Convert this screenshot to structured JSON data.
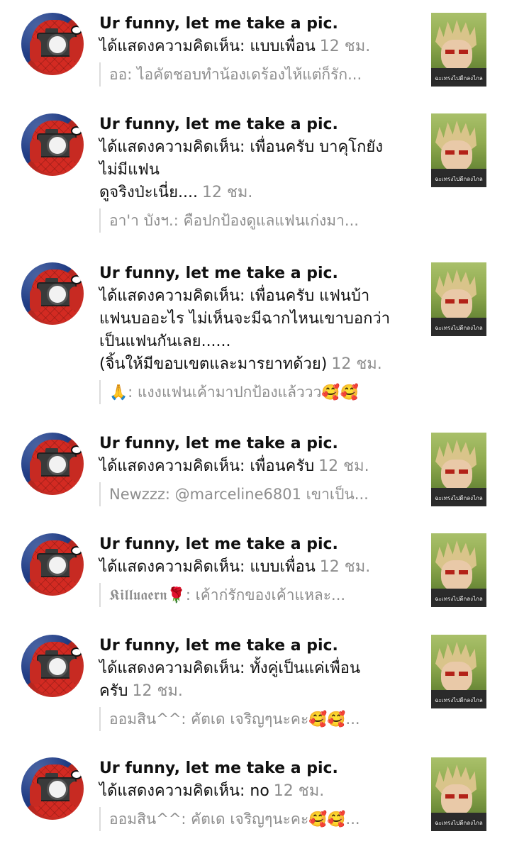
{
  "notifications": [
    {
      "author": "Ur funny, let me take a pic.",
      "comment_lines": [
        "ได้แสดงความคิดเห็น: แบบเพื่อน"
      ],
      "time": "12 ชม.",
      "reply": "ออ: ไอคัตชอบทำน้องเดร้องไห้แต่ก็รัก...",
      "thumbnail_caption": "ฉะเทรงไปดีกลงไกล"
    },
    {
      "author": "Ur funny, let me take a pic.",
      "comment_lines": [
        "ได้แสดงความคิดเห็น: เพื่อนครับ บาคุโกยัง",
        "ไม่มีแฟน",
        "ดูจริงป่ะเนี่ย...."
      ],
      "time": "12 ชม.",
      "reply": "อา'า บังฯ.: คือปกป้องดูแลแฟนเก่งมา...",
      "thumbnail_caption": "ฉะเทรงไปดีกลงไกล"
    },
    {
      "author": "Ur funny, let me take a pic.",
      "comment_lines": [
        "ได้แสดงความคิดเห็น: เพื่อนครับ แฟนบ้า",
        "แฟนบออะไร ไม่เห็นจะมีฉากไหนเขาบอกว่า",
        "เป็นแฟนกันเลย......",
        "(จิ้นให้มีขอบเขตและมารยาทด้วย)"
      ],
      "time": "12 ชม.",
      "reply": "🙏: แงงแฟนเค้ามาปกป้องแล้ววว🥰🥰",
      "thumbnail_caption": "ฉะเทรงไปดีกลงไกล"
    },
    {
      "author": "Ur funny, let me take a pic.",
      "comment_lines": [
        "ได้แสดงความคิดเห็น: เพื่อนครับ"
      ],
      "time": "12 ชม.",
      "reply": "Newzzz: @marceline6801 เขาเป็น...",
      "thumbnail_caption": "ฉะเทรงไปดีกลงไกล"
    },
    {
      "author": "Ur funny, let me take a pic.",
      "comment_lines": [
        "ได้แสดงความคิดเห็น: แบบเพื่อน"
      ],
      "time": "12 ชม.",
      "reply": "𝕶𝖎𝖑𝖑𝖚𝖆𝖊𝖗𝖓🌹: เค้าก่รักของเค้าแหละ...",
      "thumbnail_caption": "ฉะเทรงไปดีกลงไกล"
    },
    {
      "author": "Ur funny, let me take a pic.",
      "comment_lines": [
        "ได้แสดงความคิดเห็น: ทั้งคู่เป็นแค่เพื่อน",
        "ครับ"
      ],
      "time": "12 ชม.",
      "reply": "ออมสิน^^: คัตเด เจริญๆนะคะ🥰🥰...",
      "thumbnail_caption": "ฉะเทรงไปดีกลงไกล"
    },
    {
      "author": "Ur funny, let me take a pic.",
      "comment_lines": [
        "ได้แสดงความคิดเห็น: no"
      ],
      "time": "12 ชม.",
      "reply": "ออมสิน^^: คัตเด เจริญๆนะคะ🥰🥰...",
      "thumbnail_caption": "ฉะเทรงไปดีกลงไกล"
    }
  ]
}
